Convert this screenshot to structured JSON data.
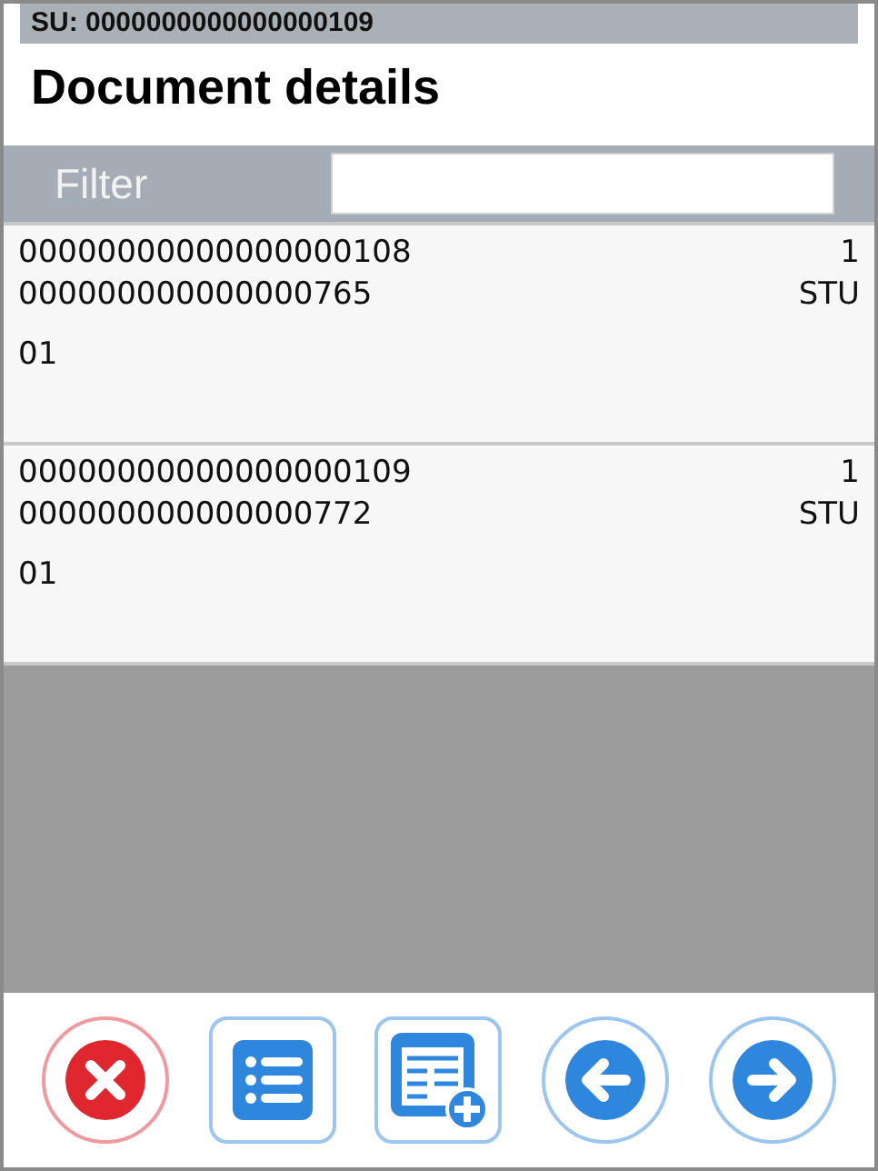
{
  "storage_unit": "SU: 0000000000000000109",
  "title": "Document details",
  "filter": {
    "label": "Filter"
  },
  "items": [
    {
      "line_1": "00000000000000000108",
      "quantity": "1",
      "line_2": "000000000000000765",
      "unit": "STU",
      "line_3": "01"
    },
    {
      "line_1": "00000000000000000109",
      "quantity": "1",
      "line_2": "000000000000000772",
      "unit": "STU",
      "line_3": "01"
    }
  ],
  "toolbar": [
    {
      "kind": "cancel"
    },
    {
      "kind": "list"
    },
    {
      "kind": "add"
    },
    {
      "kind": "back"
    },
    {
      "kind": "forward"
    }
  ]
}
